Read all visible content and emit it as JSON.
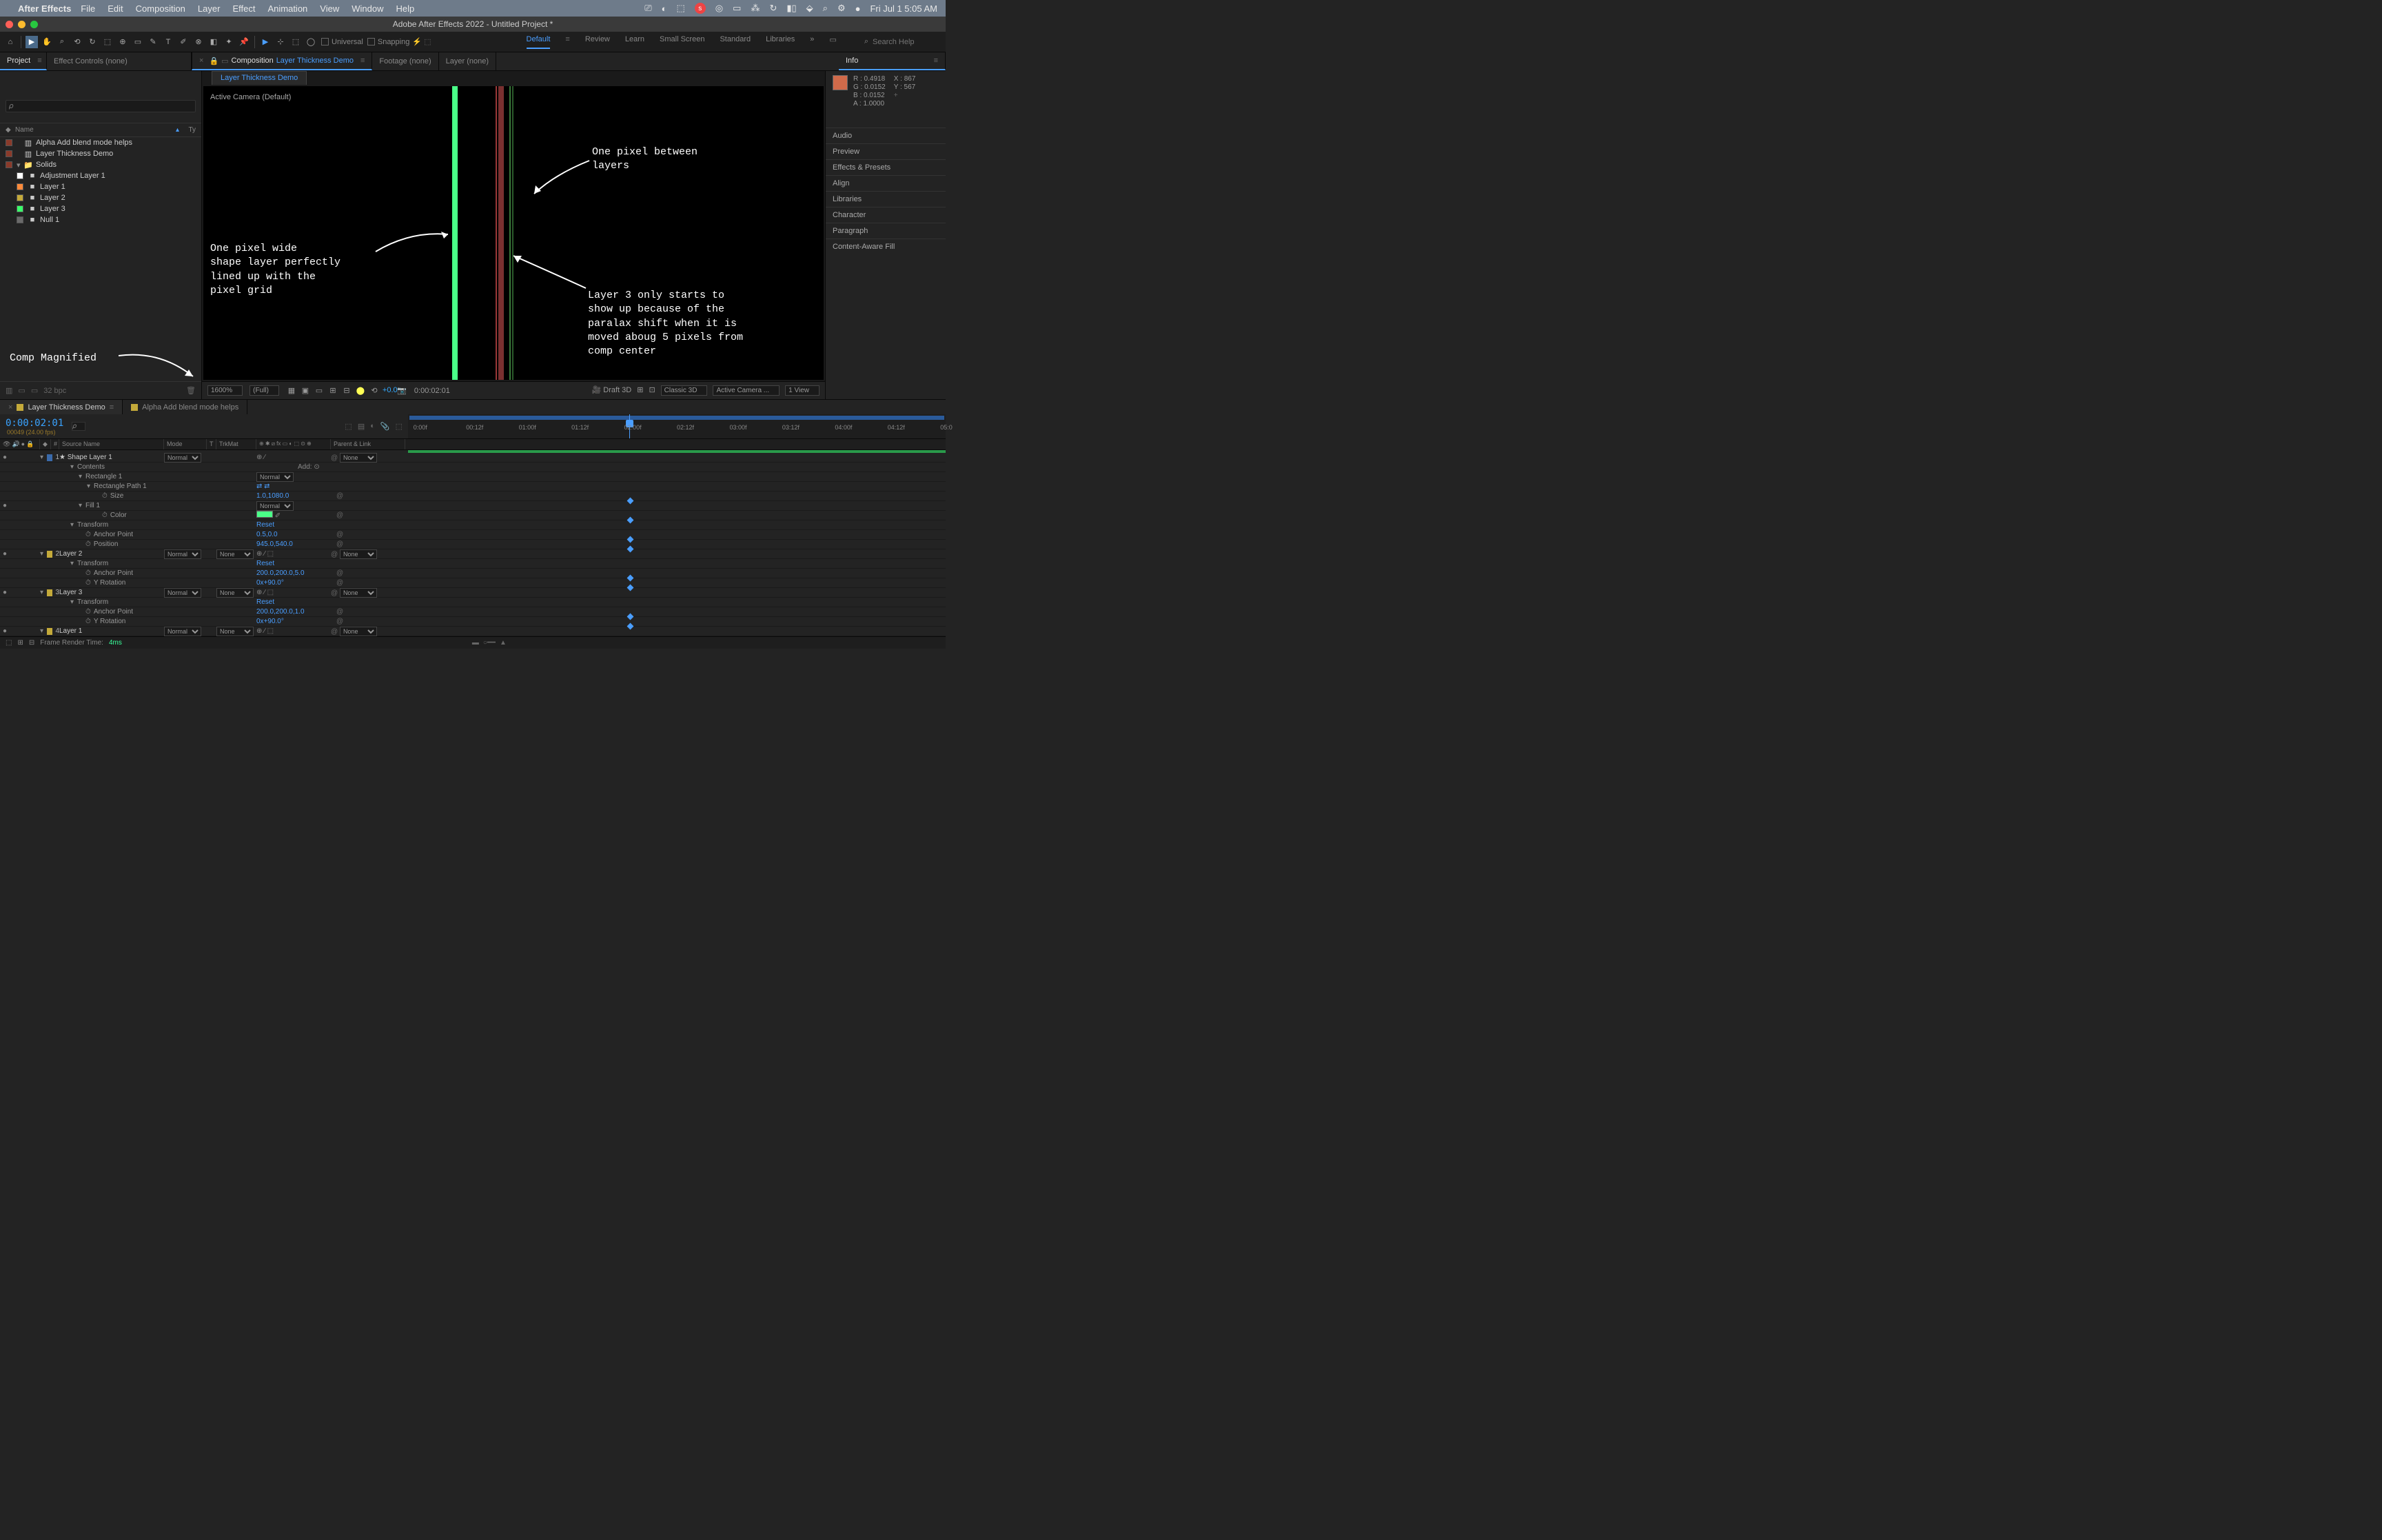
{
  "menubar": {
    "app": "After Effects",
    "items": [
      "File",
      "Edit",
      "Composition",
      "Layer",
      "Effect",
      "Animation",
      "View",
      "Window",
      "Help"
    ],
    "clock": "Fri Jul 1  5:05 AM"
  },
  "window": {
    "title": "Adobe After Effects 2022 - Untitled Project *"
  },
  "toolbar": {
    "universal": "Universal",
    "snapping": "Snapping",
    "workspaces": [
      "Default",
      "Review",
      "Learn",
      "Small Screen",
      "Standard",
      "Libraries"
    ],
    "active_workspace": "Default",
    "search_placeholder": "Search Help"
  },
  "panel_tabs": {
    "project": "Project",
    "effect_controls": "Effect Controls (none)",
    "composition": "Composition",
    "comp_name": "Layer Thickness Demo",
    "footage": "Footage (none)",
    "layer": "Layer (none)",
    "info": "Info"
  },
  "project": {
    "cols": {
      "name": "Name",
      "type": "Ty"
    },
    "items": [
      {
        "sw": "#8a3a2a",
        "icon": "comp",
        "name": "Alpha Add blend mode helps",
        "indent": 0
      },
      {
        "sw": "#8a3a2a",
        "icon": "comp",
        "name": "Layer Thickness Demo",
        "indent": 0
      },
      {
        "sw": "#8a3a2a",
        "icon": "folder",
        "name": "Solids",
        "indent": 0,
        "expanded": true
      },
      {
        "sw": "#ffffff",
        "icon": "solid",
        "name": "Adjustment Layer 1",
        "indent": 1
      },
      {
        "sw": "#ff8a3a",
        "icon": "solid",
        "name": "Layer 1",
        "indent": 1
      },
      {
        "sw": "#c4aa3a",
        "icon": "solid",
        "name": "Layer 2",
        "indent": 1
      },
      {
        "sw": "#3aff6a",
        "icon": "solid",
        "name": "Layer 3",
        "indent": 1
      },
      {
        "sw": "#6a6a6a",
        "icon": "solid",
        "name": "Null 1",
        "indent": 1
      }
    ],
    "footer_bpc": "32 bpc"
  },
  "comp": {
    "tab": "Layer Thickness Demo",
    "active_camera": "Active Camera (Default)",
    "footer": {
      "mag": "1600%",
      "res": "(Full)",
      "exposure": "+0.0",
      "timecode": "0:00:02:01",
      "draft3d": "Draft 3D",
      "renderer": "Classic 3D",
      "camera": "Active Camera ...",
      "views": "1 View"
    }
  },
  "annotations": {
    "a1": "One pixel wide\nshape layer perfectly\nlined up with the\npixel grid",
    "a2": "One pixel between\nlayers",
    "a3": "Layer 3 only starts to\nshow up because of the\nparalax shift when it is\nmoved aboug 5 pixels from\ncomp center",
    "a4": "Comp Magnified"
  },
  "info": {
    "R": "R :  0.4918",
    "G": "G :  0.0152",
    "B": "B :  0.0152",
    "A": "A :  1.0000",
    "X": "X :  867",
    "Y": "Y :  567"
  },
  "right_panels": [
    "Audio",
    "Preview",
    "Effects & Presets",
    "Align",
    "Libraries",
    "Character",
    "Paragraph",
    "Content-Aware Fill"
  ],
  "timeline": {
    "tabs": [
      {
        "sw": "#c4aa3a",
        "label": "Layer Thickness Demo",
        "active": true
      },
      {
        "sw": "#c4aa3a",
        "label": "Alpha Add blend mode helps",
        "active": false
      }
    ],
    "timecode": "0:00:02:01",
    "fps": "00049 (24.00 fps)",
    "search_ph": "",
    "cols": {
      "source": "Source Name",
      "mode": "Mode",
      "trkmat": "TrkMat",
      "parent": "Parent & Link"
    },
    "ruler": [
      "0:00f",
      "00:12f",
      "01:00f",
      "01:12f",
      "02:00f",
      "02:12f",
      "03:00f",
      "03:12f",
      "04:00f",
      "04:12f",
      "05:0"
    ],
    "layers": [
      {
        "idx": 1,
        "sw": "#3a6aaa",
        "star": true,
        "name": "Shape Layer 1",
        "mode": "Normal",
        "trk": "",
        "parent": "None",
        "bar": "#6a7aaa",
        "children": [
          {
            "name": "Contents",
            "ind": 1,
            "add": "Add:"
          },
          {
            "name": "Rectangle 1",
            "ind": 2,
            "mode": "Normal"
          },
          {
            "name": "Rectangle Path 1",
            "ind": 3,
            "switches": "⇄ ⇄"
          },
          {
            "name": "Size",
            "ind": 4,
            "val": "1.0,1080.0",
            "link": true,
            "stopwatch": true
          },
          {
            "name": "Fill 1",
            "ind": 2,
            "mode": "Normal"
          },
          {
            "name": "Color",
            "ind": 4,
            "val_swatch": "#4aff88",
            "link": true,
            "stopwatch": true
          },
          {
            "name": "Transform",
            "ind": 1,
            "reset": "Reset"
          },
          {
            "name": "Anchor Point",
            "ind": 2,
            "val": "0.5,0.0",
            "link": true,
            "stopwatch": true
          },
          {
            "name": "Position",
            "ind": 2,
            "val": "945.0,540.0",
            "link": true,
            "stopwatch": true
          }
        ]
      },
      {
        "idx": 2,
        "sw": "#c4aa3a",
        "name": "Layer 2",
        "mode": "Normal",
        "trk": "None",
        "parent": "None",
        "bar": "#c4aa3a",
        "cube": true,
        "children": [
          {
            "name": "Transform",
            "ind": 1,
            "reset": "Reset"
          },
          {
            "name": "Anchor Point",
            "ind": 2,
            "val": "200.0,200.0,5.0",
            "link": true,
            "stopwatch": true
          },
          {
            "name": "Y Rotation",
            "ind": 2,
            "val": "0x+90.0°",
            "link": true,
            "stopwatch": true
          }
        ]
      },
      {
        "idx": 3,
        "sw": "#c4aa3a",
        "name": "Layer 3",
        "mode": "Normal",
        "trk": "None",
        "parent": "None",
        "bar": "#c4aa3a",
        "cube": true,
        "children": [
          {
            "name": "Transform",
            "ind": 1,
            "reset": "Reset"
          },
          {
            "name": "Anchor Point",
            "ind": 2,
            "val": "200.0,200.0,1.0",
            "link": true,
            "stopwatch": true
          },
          {
            "name": "Y Rotation",
            "ind": 2,
            "val": "0x+90.0°",
            "link": true,
            "stopwatch": true
          }
        ]
      },
      {
        "idx": 4,
        "sw": "#c4aa3a",
        "name": "Layer 1",
        "mode": "Normal",
        "trk": "None",
        "parent": "None",
        "bar": "#c4aa3a",
        "cube": true
      }
    ],
    "frame_render_label": "Frame Render Time:",
    "frame_render_time": "4ms"
  }
}
